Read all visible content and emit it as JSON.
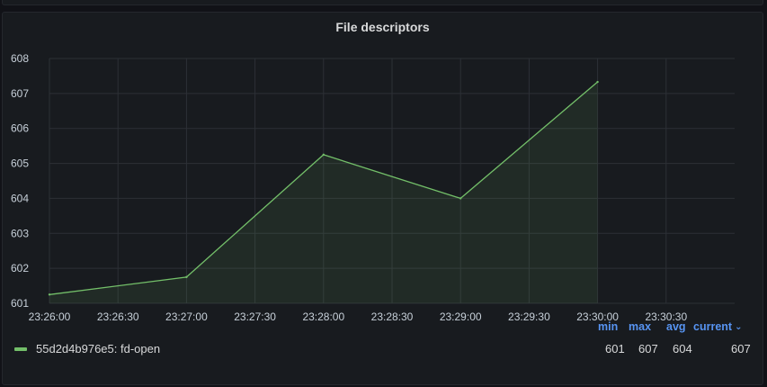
{
  "panel": {
    "title": "File descriptors"
  },
  "chart_data": {
    "type": "area",
    "title": "File descriptors",
    "xlabel": "",
    "ylabel": "",
    "x_ticks": [
      "23:26:00",
      "23:26:30",
      "23:27:00",
      "23:27:30",
      "23:28:00",
      "23:28:30",
      "23:29:00",
      "23:29:30",
      "23:30:00",
      "23:30:30"
    ],
    "y_ticks": [
      601,
      602,
      603,
      604,
      605,
      606,
      607,
      608
    ],
    "xlim": [
      "23:26:00",
      "23:31:00"
    ],
    "ylim": [
      601,
      608
    ],
    "grid": true,
    "series": [
      {
        "name": "55d2d4b976e5: fd-open",
        "color": "#73bf69",
        "x": [
          "23:26:00",
          "23:27:00",
          "23:28:00",
          "23:29:00",
          "23:30:00"
        ],
        "y": [
          601.25,
          601.75,
          605.25,
          604,
          607.33
        ]
      }
    ]
  },
  "legend": {
    "series_label": "55d2d4b976e5: fd-open",
    "color": "#73bf69",
    "headers": {
      "min": "min",
      "max": "max",
      "avg": "avg",
      "current": "current"
    },
    "values": {
      "min": "601",
      "max": "607",
      "avg": "604",
      "current": "607"
    },
    "sort_icon": "chevron-down-icon"
  }
}
